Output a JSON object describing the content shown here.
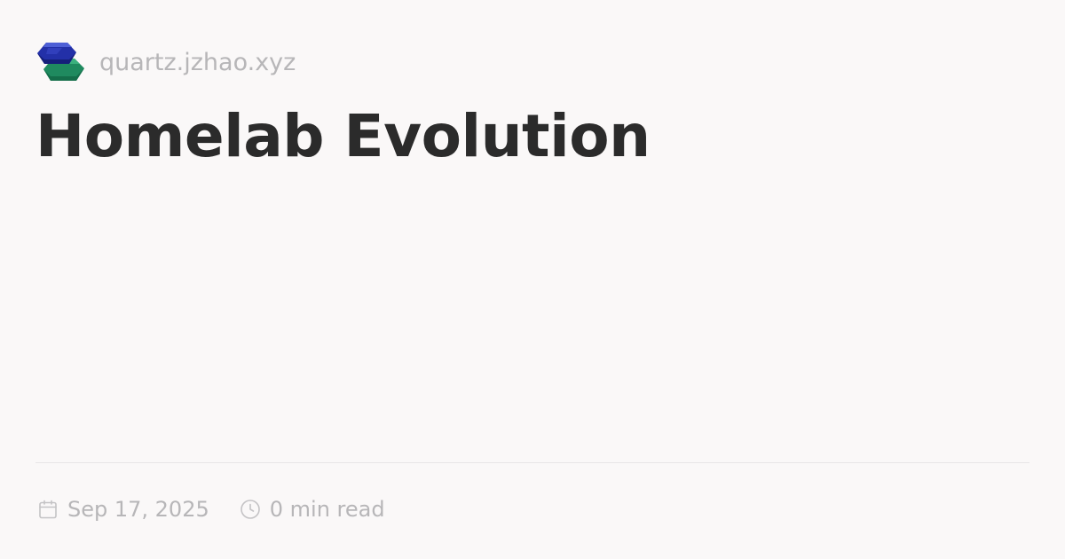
{
  "header": {
    "site_name": "quartz.jzhao.xyz",
    "logo_icon": "quartz-logo-icon"
  },
  "page": {
    "title": "Homelab Evolution"
  },
  "meta": {
    "date": "Sep 17, 2025",
    "date_icon": "calendar-icon",
    "reading_time": "0 min read",
    "reading_time_icon": "clock-icon"
  },
  "colors": {
    "background": "#faf8f8",
    "title": "#2b2b2b",
    "muted_text": "#b7b6b8",
    "divider": "#e7e5e6",
    "logo_blue": "#2330a8",
    "logo_green": "#1f8a5f"
  }
}
